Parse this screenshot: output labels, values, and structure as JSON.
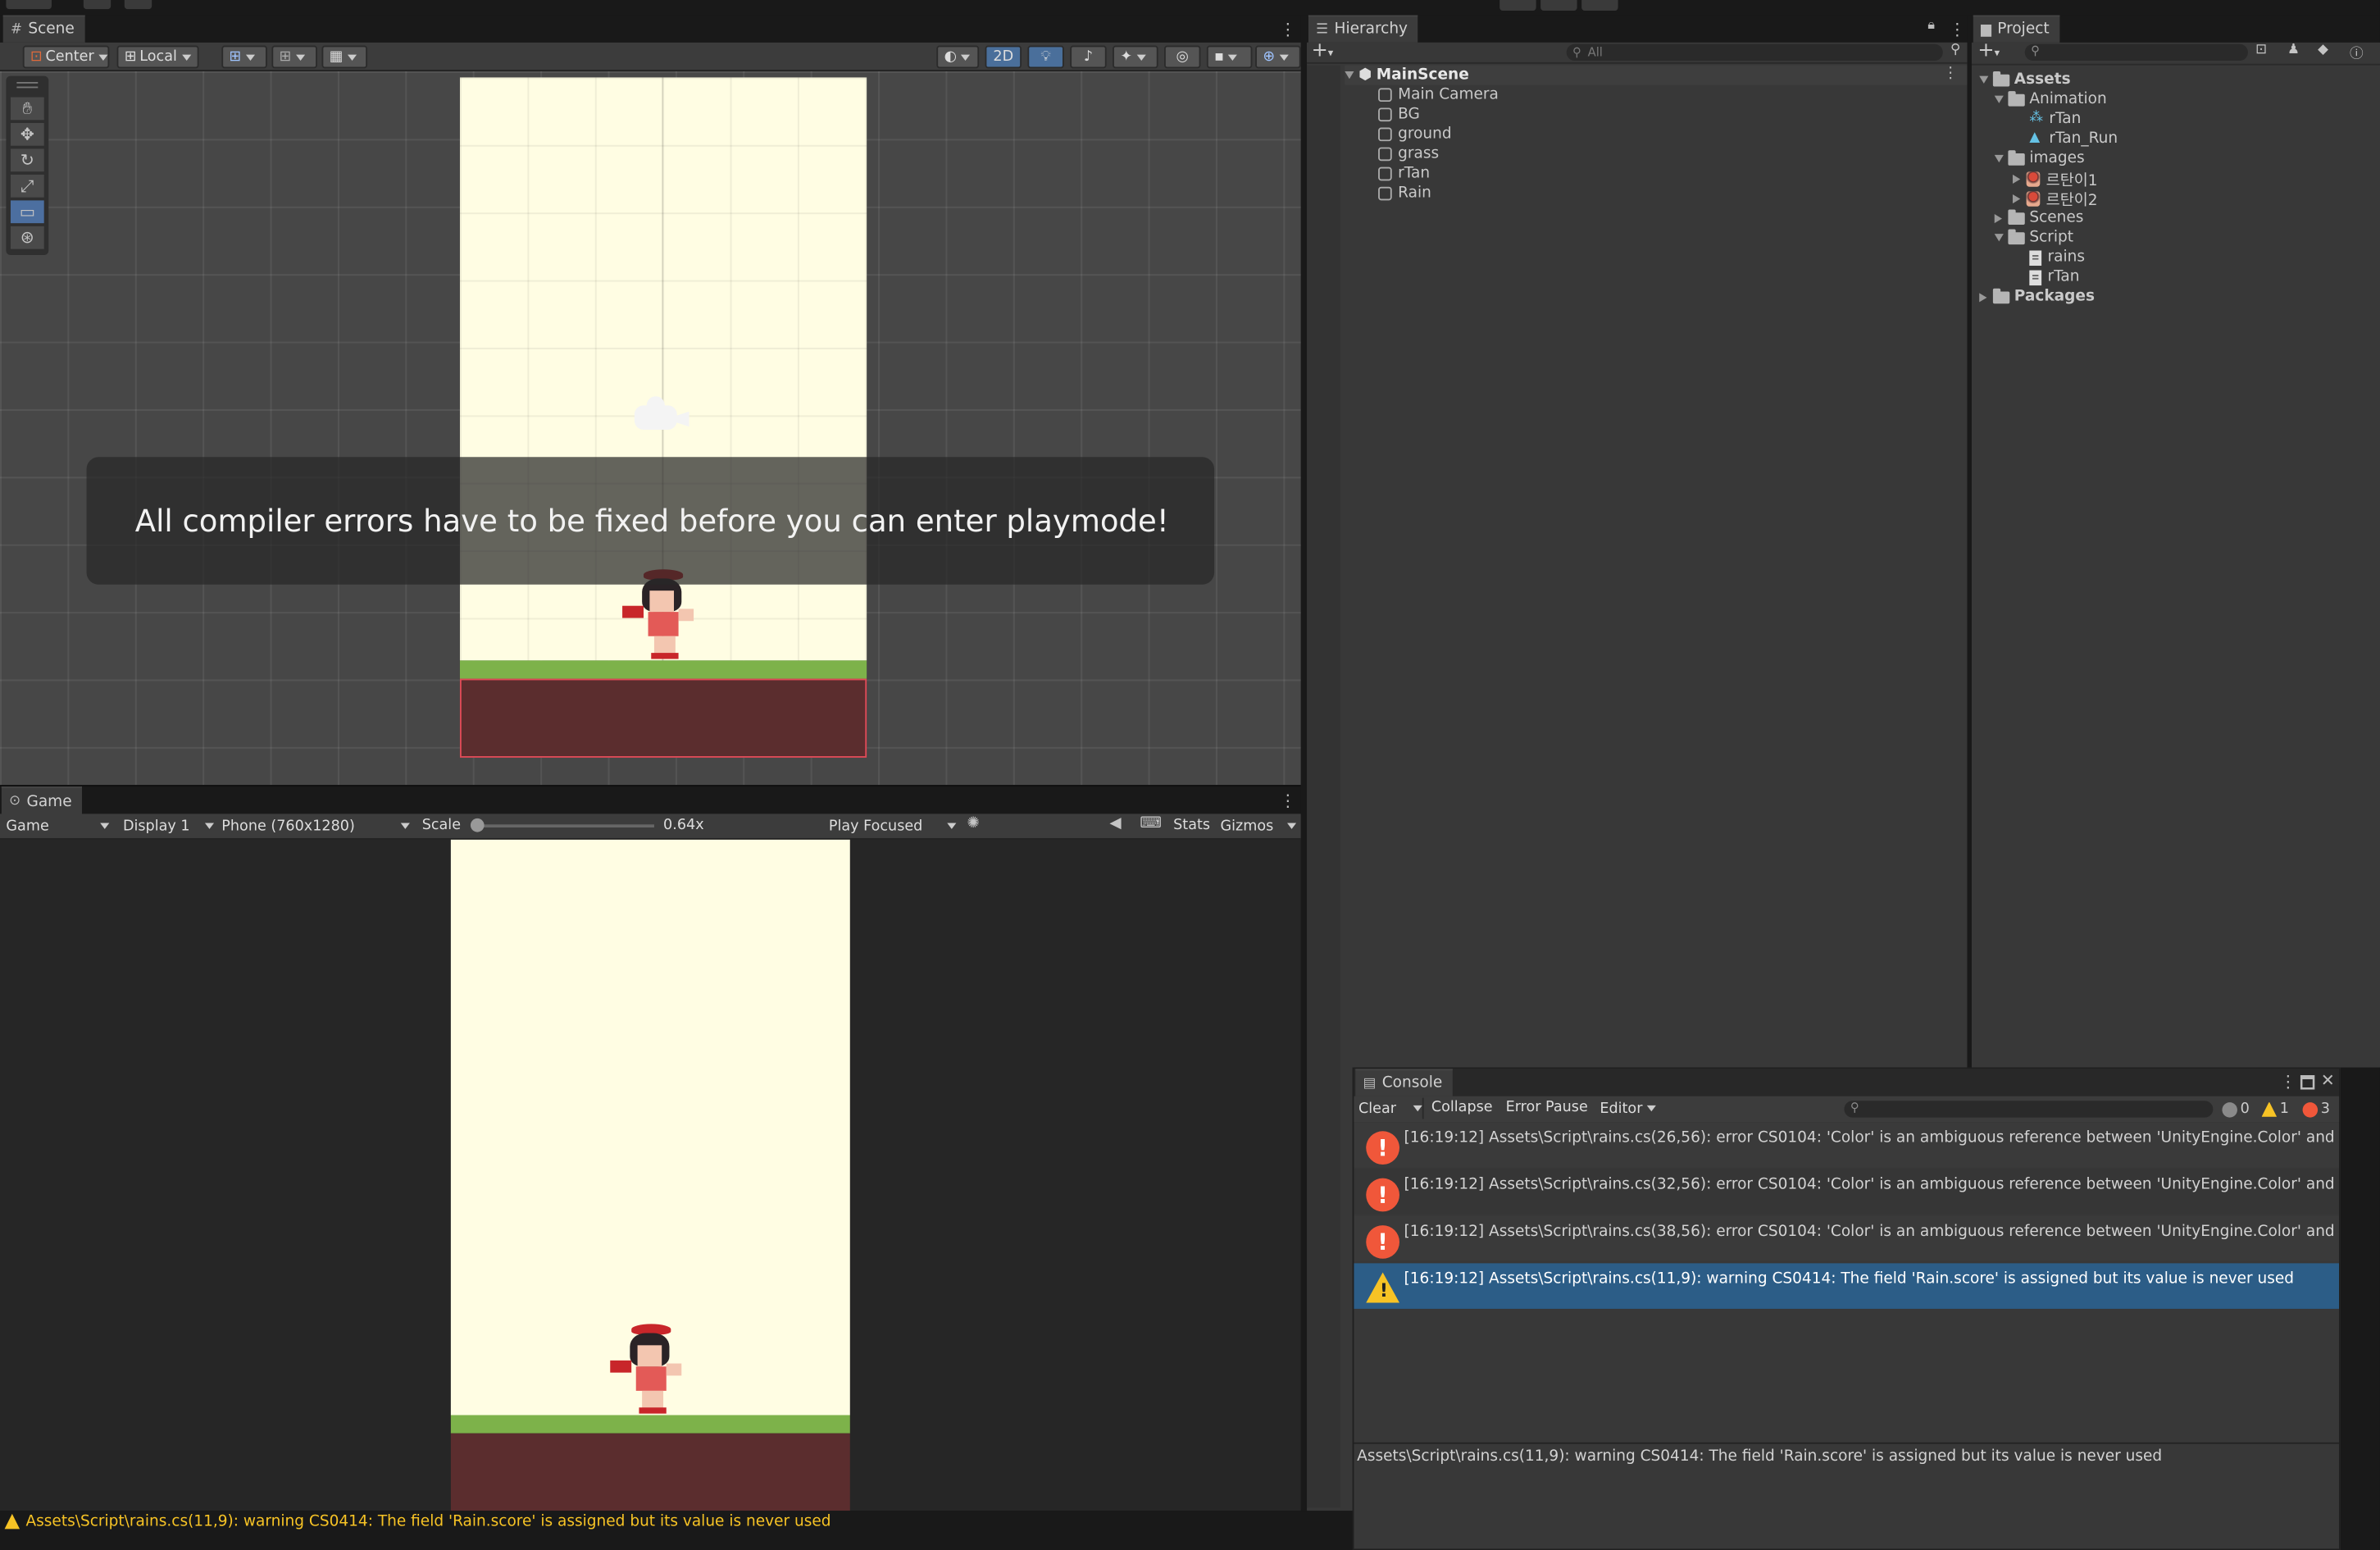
{
  "scene": {
    "tab_label": "Scene",
    "pivot_mode": "Center",
    "pivot_space": "Local",
    "mode_2d": "2D",
    "overlay_message": "All compiler errors have to be fixed before you can enter playmode!"
  },
  "game": {
    "tab_label": "Game",
    "view_select": "Game",
    "display": "Display 1",
    "resolution": "Phone (760x1280)",
    "scale_label": "Scale",
    "scale_value": "0.64x",
    "scale_fraction": 0.0,
    "play_mode": "Play Focused",
    "stats": "Stats",
    "gizmos": "Gizmos"
  },
  "hierarchy": {
    "tab_label": "Hierarchy",
    "search_placeholder": "All",
    "scene_name": "MainScene",
    "objects": [
      "Main Camera",
      "BG",
      "ground",
      "grass",
      "rTan",
      "Rain"
    ]
  },
  "project": {
    "tab_label": "Project",
    "tree": {
      "assets": "Assets",
      "animation": "Animation",
      "anim_controller": "rTan",
      "anim_clip": "rTan_Run",
      "images": "images",
      "image1": "르탄이1",
      "image2": "르탄이2",
      "scenes": "Scenes",
      "script": "Script",
      "script1": "rains",
      "script2": "rTan",
      "packages": "Packages"
    }
  },
  "console": {
    "tab_label": "Console",
    "clear": "Clear",
    "collapse": "Collapse",
    "error_pause": "Error Pause",
    "editor": "Editor",
    "count_info": "0",
    "count_warn": "1",
    "count_error": "3",
    "logs": [
      {
        "type": "error",
        "text": "[16:19:12] Assets\\Script\\rains.cs(26,56): error CS0104: 'Color' is an ambiguous reference between 'UnityEngine.Color' and 'System.D"
      },
      {
        "type": "error",
        "text": "[16:19:12] Assets\\Script\\rains.cs(32,56): error CS0104: 'Color' is an ambiguous reference between 'UnityEngine.Color' and 'System.D"
      },
      {
        "type": "error",
        "text": "[16:19:12] Assets\\Script\\rains.cs(38,56): error CS0104: 'Color' is an ambiguous reference between 'UnityEngine.Color' and 'System.D"
      },
      {
        "type": "warning",
        "text": "[16:19:12] Assets\\Script\\rains.cs(11,9): warning CS0414: The field 'Rain.score' is assigned but its value is never used"
      }
    ],
    "detail": "Assets\\Script\\rains.cs(11,9): warning CS0414: The field 'Rain.score' is assigned but its value is never used"
  },
  "status_bar": {
    "message": "Assets\\Script\\rains.cs(11,9): warning CS0414: The field 'Rain.score' is assigned but its value is never used"
  },
  "colors": {
    "editor_bg": "#383838",
    "selection": "#2c5d87",
    "error": "#f0573a",
    "warning": "#f7c325",
    "sky": "#fffde3",
    "grass": "#7db24a",
    "dirt": "#5b2d2e"
  }
}
